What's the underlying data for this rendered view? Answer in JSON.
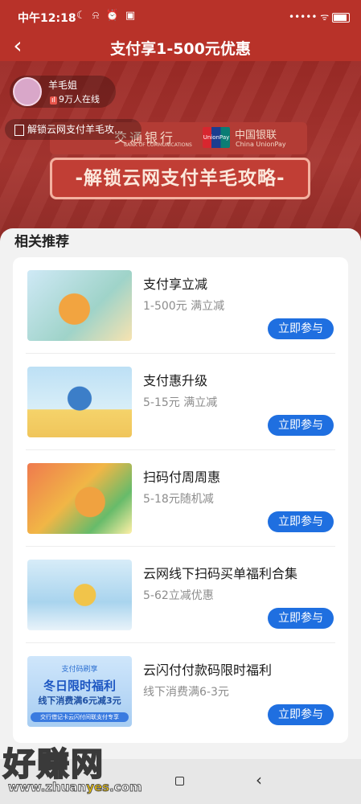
{
  "status_bar": {
    "time": "中午12:18",
    "status_icons": "☾ ⍾ ⏰ ▣",
    "signal_icons": "••••• ᯤ"
  },
  "header": {
    "back_icon": "‹",
    "title": "支付享1-500元优惠"
  },
  "banner": {
    "host_name": "羊毛姐",
    "viewers": "9万人在线",
    "viewers_icon": "ıl",
    "notice": "解锁云网支付羊毛攻...",
    "bank_name": "交通银行",
    "bank_name_en": "BANK OF COMMUNICATIONS",
    "unionpay_mark": "UnionPay",
    "unionpay_cn": "中国银联",
    "unionpay_en": "China UnionPay",
    "slogan": "-解锁云网支付羊毛攻略-"
  },
  "section": {
    "title": "相关推荐"
  },
  "items": [
    {
      "title": "支付享立减",
      "desc": "1-500元 满立减",
      "button": "立即参与"
    },
    {
      "title": "支付惠升级",
      "desc": "5-15元 满立减",
      "button": "立即参与"
    },
    {
      "title": "扫码付周周惠",
      "desc": "5-18元随机减",
      "button": "立即参与"
    },
    {
      "title": "云网线下扫码买单福利合集",
      "desc": "5-62立减优惠",
      "button": "立即参与"
    },
    {
      "title": "云闪付付款码限时福利",
      "desc": "线下消费满6-3元",
      "button": "立即参与"
    }
  ],
  "thumb5_text": {
    "line1": "支付码刷享",
    "line2": "冬日限时福利",
    "line3": "线下消费满6元减3元",
    "line4": "交行借记卡云闪付间联支付专享"
  },
  "nav_bar": {
    "home_icon": "square-icon",
    "back_icon": "‹"
  },
  "watermark": {
    "text": "好赚网",
    "url_a": "www.zhuan",
    "url_b": "yes",
    "url_c": ".com"
  }
}
